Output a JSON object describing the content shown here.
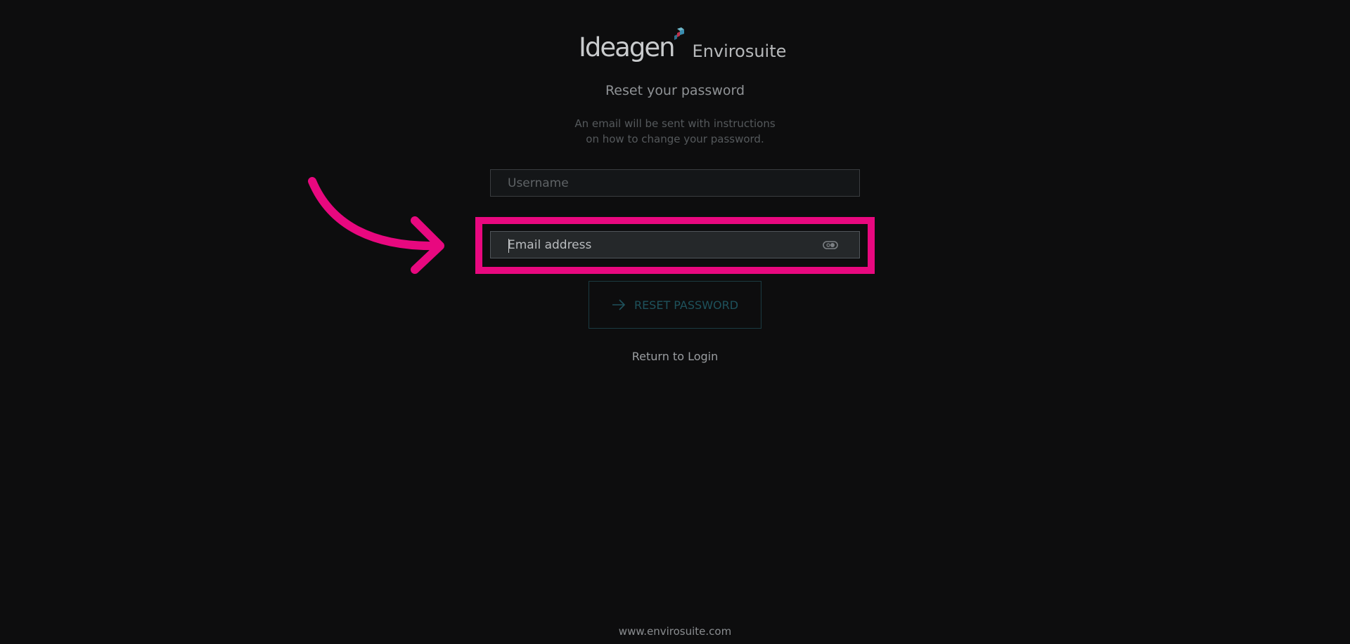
{
  "brand": {
    "name_primary": "Ideagen",
    "name_secondary": "Envirosuite",
    "colors": {
      "mark_blue": "#3a8db0",
      "mark_red": "#c0304a",
      "mark_teal": "#6fb7c9"
    }
  },
  "form": {
    "title": "Reset your password",
    "subtitle_line1": "An email will be sent with instructions",
    "subtitle_line2": "on how to change your password.",
    "username_placeholder": "Username",
    "email_placeholder": "Email address",
    "reset_button_label": "RESET PASSWORD",
    "return_link": "Return to Login"
  },
  "footer": {
    "website": "www.envirosuite.com"
  },
  "annotation": {
    "highlight_color": "#e8087f",
    "icon": "arrow-right-icon"
  },
  "icons": {
    "password_toggle": "password-toggle-icon",
    "button": "arrow-right-icon"
  }
}
